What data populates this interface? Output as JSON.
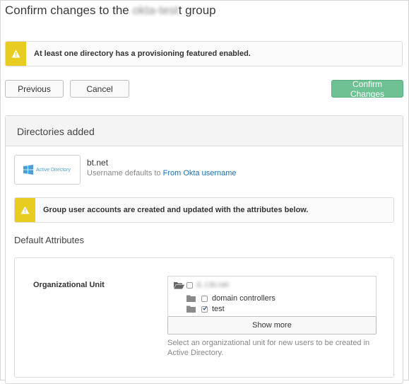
{
  "header": {
    "title_prefix": "Confirm changes to the",
    "group_name_blurred": "okta-test",
    "title_suffix": "t group"
  },
  "banner_top": {
    "message": "At least one directory has a provisioning featured enabled.",
    "icon": "warning-icon",
    "color": "#e7cc21"
  },
  "actions": {
    "previous_label": "Previous",
    "cancel_label": "Cancel",
    "confirm_label": "Confirm Changes",
    "confirm_color": "#6ec193"
  },
  "panel": {
    "title": "Directories added",
    "directory": {
      "logo_text": "Active Directory",
      "name": "bt.net",
      "username_prefix": "Username defaults to",
      "username_link": "From Okta username"
    },
    "banner": {
      "message": "Group user accounts are created and updated with the attributes below.",
      "icon": "warning-icon"
    },
    "default_attributes_label": "Default Attributes",
    "org_unit": {
      "label": "Organizational Unit",
      "tree": {
        "root_blurred": "d..t.bt.net",
        "children": [
          {
            "label": "domain controllers",
            "checked": false
          },
          {
            "label": "test",
            "checked": true
          }
        ]
      },
      "show_more_label": "Show more",
      "help_text": "Select an organizational unit for new users to be created in Active Directory."
    }
  }
}
